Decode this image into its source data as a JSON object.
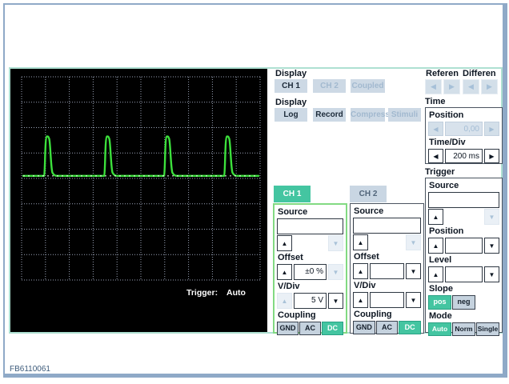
{
  "window": {
    "footer_code": "FB6110061"
  },
  "icons": {
    "up": "▲",
    "down": "▼",
    "left": "◀",
    "right": "▶"
  },
  "colors": {
    "accent_teal": "#44c5a1",
    "trace_green": "#3ce03c",
    "grid_color": "#9aa2b6",
    "scope_bg": "#000000",
    "button_blue": "#cdd9e5",
    "frame_blue": "#8fa9c7",
    "panel_teal_border": "#aee0d2",
    "ch1_border_green": "#82da82"
  },
  "scope": {
    "trigger_status_label": "Trigger:",
    "trigger_status_value": "Auto",
    "grid": {
      "cols": 10,
      "rows": 8
    },
    "waveform": {
      "baseline_div": 3.9,
      "peak_div": 2.35,
      "pulse_starts_div": [
        0.94,
        3.46,
        5.97,
        8.49
      ]
    }
  },
  "display_channels": {
    "label": "Display",
    "buttons": [
      {
        "label": "CH 1",
        "enabled": true
      },
      {
        "label": "CH 2",
        "enabled": false
      },
      {
        "label": "Coupled",
        "enabled": false
      }
    ]
  },
  "display_modes": {
    "label": "Display",
    "buttons": [
      {
        "label": "Log",
        "enabled": true
      },
      {
        "label": "Record",
        "enabled": true
      },
      {
        "label": "Compress",
        "enabled": false
      },
      {
        "label": "Stimuli",
        "enabled": false
      }
    ]
  },
  "reference": {
    "label": "Referen"
  },
  "difference": {
    "label": "Differen"
  },
  "time": {
    "label": "Time",
    "position_label": "Position",
    "position_value": "0,00",
    "timediv_label": "Time/Div",
    "timediv_value": "200 ms"
  },
  "trigger": {
    "label": "Trigger",
    "source_label": "Source",
    "source_value": "",
    "position_label": "Position",
    "position_value": "",
    "level_label": "Level",
    "level_value": "",
    "slope_label": "Slope",
    "slope_pos": "pos",
    "slope_neg": "neg",
    "mode_label": "Mode",
    "mode_auto": "Auto",
    "mode_norm": "Norm",
    "mode_single": "Single"
  },
  "ch1": {
    "tab_label": "CH 1",
    "source_label": "Source",
    "source_value": "",
    "offset_label": "Offset",
    "offset_value": "±0 %",
    "vdiv_label": "V/Div",
    "vdiv_value": "5 V",
    "coupling_label": "Coupling",
    "coupling_gnd": "GND",
    "coupling_ac": "AC",
    "coupling_dc": "DC"
  },
  "ch2": {
    "tab_label": "CH 2",
    "source_label": "Source",
    "source_value": "",
    "offset_label": "Offset",
    "offset_value": "",
    "vdiv_label": "V/Div",
    "vdiv_value": "",
    "coupling_label": "Coupling",
    "coupling_gnd": "GND",
    "coupling_ac": "AC",
    "coupling_dc": "DC"
  }
}
